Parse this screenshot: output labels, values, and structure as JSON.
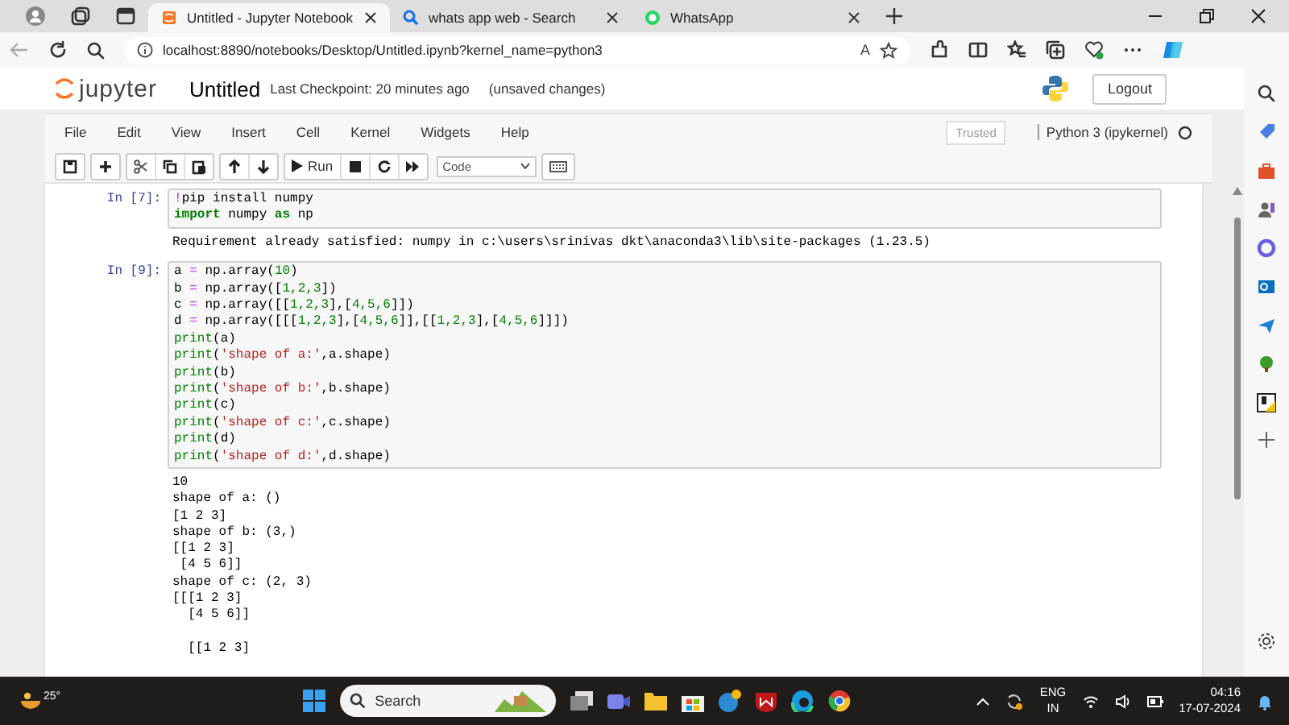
{
  "browser": {
    "tabs": [
      {
        "kind": "jupyter",
        "title": "Untitled - Jupyter Notebook",
        "selected": true
      },
      {
        "kind": "search",
        "title": "whats app web - Search",
        "selected": false
      },
      {
        "kind": "whatsapp",
        "title": "WhatsApp",
        "selected": false
      }
    ],
    "address": "localhost:8890/notebooks/Desktop/Untitled.ipynb?kernel_name=python3",
    "read_aloud": "A"
  },
  "notebook": {
    "logo": "jupyter",
    "name": "Untitled",
    "checkpoint": "Last Checkpoint: 20 minutes ago",
    "save_status": "(unsaved changes)",
    "logout": "Logout",
    "menu": [
      "File",
      "Edit",
      "View",
      "Insert",
      "Cell",
      "Kernel",
      "Widgets",
      "Help"
    ],
    "trusted": "Trusted",
    "kernel": "Python 3 (ipykernel)",
    "run": "Run",
    "cell_type": "Code"
  },
  "cells": [
    {
      "prompt": "In [7]:",
      "code": [
        [
          {
            "kind": "op",
            "text": "!"
          },
          {
            "kind": "plain",
            "text": "pip install numpy"
          }
        ],
        [
          {
            "kind": "kw",
            "text": "import"
          },
          {
            "kind": "plain",
            "text": " numpy "
          },
          {
            "kind": "kw",
            "text": "as"
          },
          {
            "kind": "plain",
            "text": " np"
          }
        ]
      ],
      "output": "Requirement already satisfied: numpy in c:\\users\\srinivas dkt\\anaconda3\\lib\\site-packages (1.23.5)"
    },
    {
      "prompt": "In [9]:",
      "code": [
        [
          {
            "kind": "plain",
            "text": "a "
          },
          {
            "kind": "op",
            "text": "="
          },
          {
            "kind": "plain",
            "text": " np.array("
          },
          {
            "kind": "num",
            "text": "10"
          },
          {
            "kind": "plain",
            "text": ")"
          }
        ],
        [
          {
            "kind": "plain",
            "text": "b "
          },
          {
            "kind": "op",
            "text": "="
          },
          {
            "kind": "plain",
            "text": " np.array(["
          },
          {
            "kind": "num",
            "text": "1,2,3"
          },
          {
            "kind": "plain",
            "text": "])"
          }
        ],
        [
          {
            "kind": "plain",
            "text": "c "
          },
          {
            "kind": "op",
            "text": "="
          },
          {
            "kind": "plain",
            "text": " np.array([["
          },
          {
            "kind": "num",
            "text": "1,2,3"
          },
          {
            "kind": "plain",
            "text": "],["
          },
          {
            "kind": "num",
            "text": "4,5,6"
          },
          {
            "kind": "plain",
            "text": "]])"
          }
        ],
        [
          {
            "kind": "plain",
            "text": "d "
          },
          {
            "kind": "op",
            "text": "="
          },
          {
            "kind": "plain",
            "text": " np.array([[["
          },
          {
            "kind": "num",
            "text": "1,2,3"
          },
          {
            "kind": "plain",
            "text": "],["
          },
          {
            "kind": "num",
            "text": "4,5,6"
          },
          {
            "kind": "plain",
            "text": "]],[["
          },
          {
            "kind": "num",
            "text": "1,2,3"
          },
          {
            "kind": "plain",
            "text": "],["
          },
          {
            "kind": "num",
            "text": "4,5,6"
          },
          {
            "kind": "plain",
            "text": "]]])"
          }
        ],
        [
          {
            "kind": "builtin",
            "text": "print"
          },
          {
            "kind": "plain",
            "text": "(a)"
          }
        ],
        [
          {
            "kind": "builtin",
            "text": "print"
          },
          {
            "kind": "plain",
            "text": "("
          },
          {
            "kind": "str",
            "text": "'shape of a:'"
          },
          {
            "kind": "plain",
            "text": ",a.shape)"
          }
        ],
        [
          {
            "kind": "builtin",
            "text": "print"
          },
          {
            "kind": "plain",
            "text": "(b)"
          }
        ],
        [
          {
            "kind": "builtin",
            "text": "print"
          },
          {
            "kind": "plain",
            "text": "("
          },
          {
            "kind": "str",
            "text": "'shape of b:'"
          },
          {
            "kind": "plain",
            "text": ",b.shape)"
          }
        ],
        [
          {
            "kind": "builtin",
            "text": "print"
          },
          {
            "kind": "plain",
            "text": "(c)"
          }
        ],
        [
          {
            "kind": "builtin",
            "text": "print"
          },
          {
            "kind": "plain",
            "text": "("
          },
          {
            "kind": "str",
            "text": "'shape of c:'"
          },
          {
            "kind": "plain",
            "text": ",c.shape)"
          }
        ],
        [
          {
            "kind": "builtin",
            "text": "print"
          },
          {
            "kind": "plain",
            "text": "(d)"
          }
        ],
        [
          {
            "kind": "builtin",
            "text": "print"
          },
          {
            "kind": "plain",
            "text": "("
          },
          {
            "kind": "str",
            "text": "'shape of d:'"
          },
          {
            "kind": "plain",
            "text": ",d.shape)"
          }
        ]
      ],
      "output": "10\nshape of a: ()\n[1 2 3]\nshape of b: (3,)\n[[1 2 3]\n [4 5 6]]\nshape of c: (2, 3)\n[[[1 2 3]\n  [4 5 6]]\n\n  [[1 2 3]"
    }
  ],
  "taskbar": {
    "temperature": "25°",
    "search": "Search",
    "language": "ENG",
    "region": "IN",
    "time": "04:16",
    "date": "17-07-2024"
  }
}
